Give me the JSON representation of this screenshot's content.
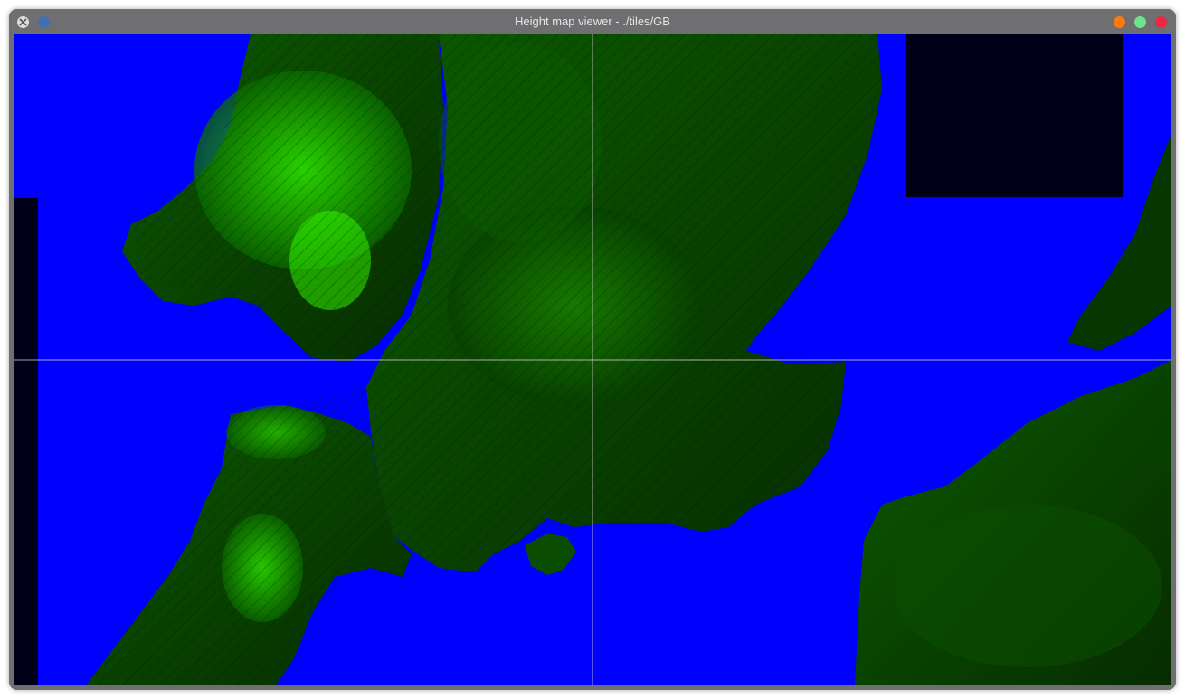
{
  "window": {
    "title": "Height map viewer - ./tiles/GB"
  },
  "titlebar_buttons": {
    "app_menu_icon": "app-menu-icon",
    "pin_icon": "pin-icon",
    "minimize_icon": "minimize-icon",
    "maximize_icon": "maximize-icon",
    "close_icon": "close-icon"
  },
  "colors": {
    "sea": "#0000ff",
    "missing_tile": "#000018",
    "land_low": "#001a00",
    "land_high": "#33ff00",
    "crosshair": "#cfcfcf",
    "titlebar": "#6f6f72",
    "minimize": "#ff7a0d",
    "maximize": "#6de68a",
    "close": "#ea2844"
  }
}
